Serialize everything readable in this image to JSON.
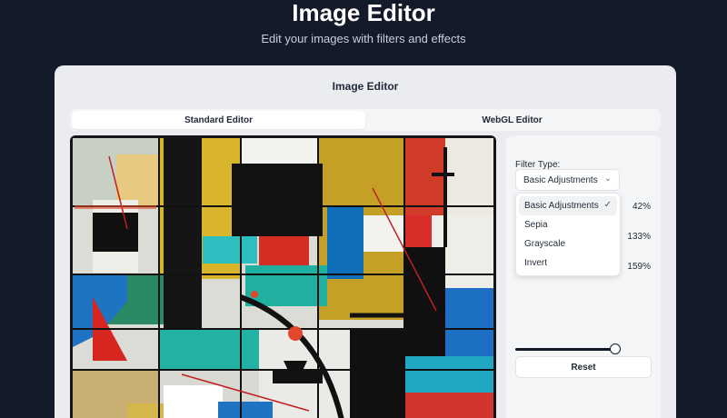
{
  "hero": {
    "title": "Image Editor",
    "subtitle": "Edit your images with filters and effects"
  },
  "card": {
    "title": "Image Editor"
  },
  "tabs": [
    {
      "label": "Standard Editor",
      "active": true
    },
    {
      "label": "WebGL Editor",
      "active": false
    }
  ],
  "controls": {
    "filter_label": "Filter Type:",
    "filter_selected": "Basic Adjustments",
    "values": [
      "42%",
      "133%",
      "159%"
    ],
    "slider_level": 0.95,
    "reset_label": "Reset"
  },
  "dropdown": {
    "options": [
      {
        "label": "Basic Adjustments",
        "selected": true
      },
      {
        "label": "Sepia",
        "selected": false
      },
      {
        "label": "Grayscale",
        "selected": false
      },
      {
        "label": "Invert",
        "selected": false
      }
    ]
  },
  "icons": {
    "select_chevron": "chevron-down-icon",
    "selected_check": "check-icon"
  },
  "colors": {
    "page_background": "#131a29",
    "card_background": "#ebecef",
    "accent_dark": "#111827"
  }
}
